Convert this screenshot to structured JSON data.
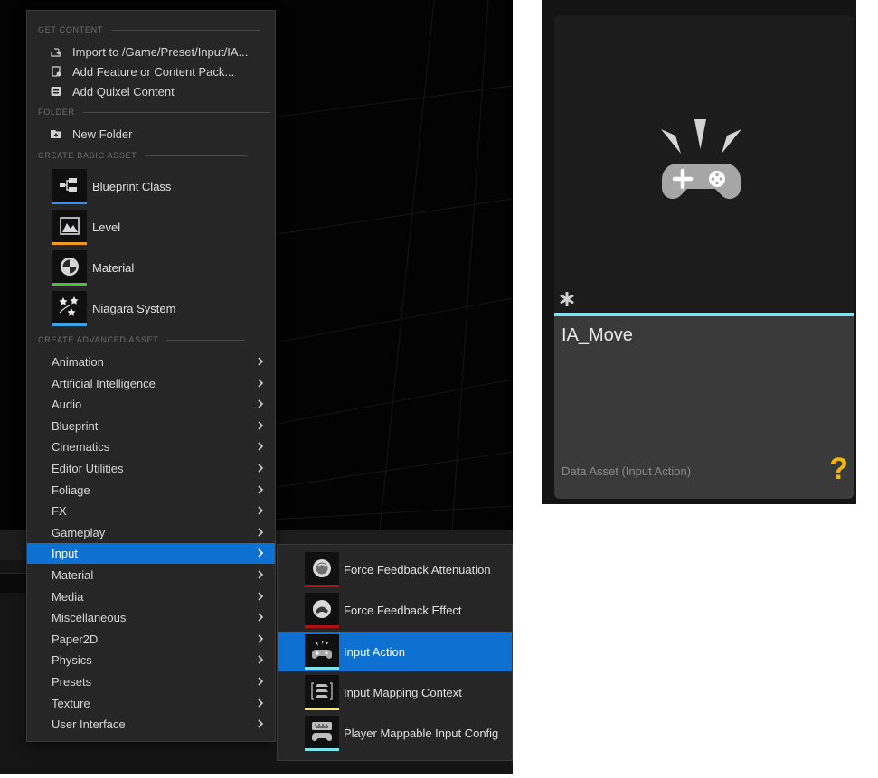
{
  "menu": {
    "sections": {
      "get_content": "GET CONTENT",
      "folder": "FOLDER",
      "create_basic_asset": "CREATE BASIC ASSET",
      "create_advanced_asset": "CREATE ADVANCED ASSET"
    },
    "get_content_items": [
      {
        "label": "Import to /Game/Preset/Input/IA...",
        "icon": "import-icon"
      },
      {
        "label": "Add Feature or Content Pack...",
        "icon": "feature-pack-icon"
      },
      {
        "label": "Add Quixel Content",
        "icon": "quixel-icon"
      }
    ],
    "folder_items": [
      {
        "label": "New Folder",
        "icon": "new-folder-icon"
      }
    ],
    "basic_assets": [
      {
        "label": "Blueprint Class",
        "icon": "blueprint-class-icon",
        "color": "#3f8cf0"
      },
      {
        "label": "Level",
        "icon": "level-icon",
        "color": "#f09a17"
      },
      {
        "label": "Material",
        "icon": "material-icon",
        "color": "#4cbf3b"
      },
      {
        "label": "Niagara System",
        "icon": "niagara-system-icon",
        "color": "#3aa2e6"
      }
    ],
    "advanced_categories": [
      "Animation",
      "Artificial Intelligence",
      "Audio",
      "Blueprint",
      "Cinematics",
      "Editor Utilities",
      "Foliage",
      "FX",
      "Gameplay",
      "Input",
      "Material",
      "Media",
      "Miscellaneous",
      "Paper2D",
      "Physics",
      "Presets",
      "Texture",
      "User Interface"
    ],
    "selected_category": "Input"
  },
  "submenu": {
    "items": [
      {
        "label": "Force Feedback Attenuation",
        "icon": "force-feedback-attenuation-icon",
        "color": "#b01313"
      },
      {
        "label": "Force Feedback Effect",
        "icon": "force-feedback-effect-icon",
        "color": "#b01313"
      },
      {
        "label": "Input Action",
        "icon": "input-action-icon",
        "color": "#7fe3ee"
      },
      {
        "label": "Input Mapping Context",
        "icon": "input-mapping-context-icon",
        "color": "#f2e27a"
      },
      {
        "label": "Player Mappable Input Config",
        "icon": "player-mappable-input-config-icon",
        "color": "#7fe3ee"
      }
    ],
    "selected": "Input Action"
  },
  "asset_tile": {
    "name": "IA_Move",
    "type": "Data Asset (Input Action)",
    "help_glyph": "?",
    "accent_color": "#7fe3ee",
    "thumbnail_icon": "gamepad-input-action-icon",
    "modified_icon": "asterisk-icon"
  },
  "colors": {
    "menu_bg": "#262626",
    "selection": "#0e70d1",
    "help": "#f7b500"
  }
}
